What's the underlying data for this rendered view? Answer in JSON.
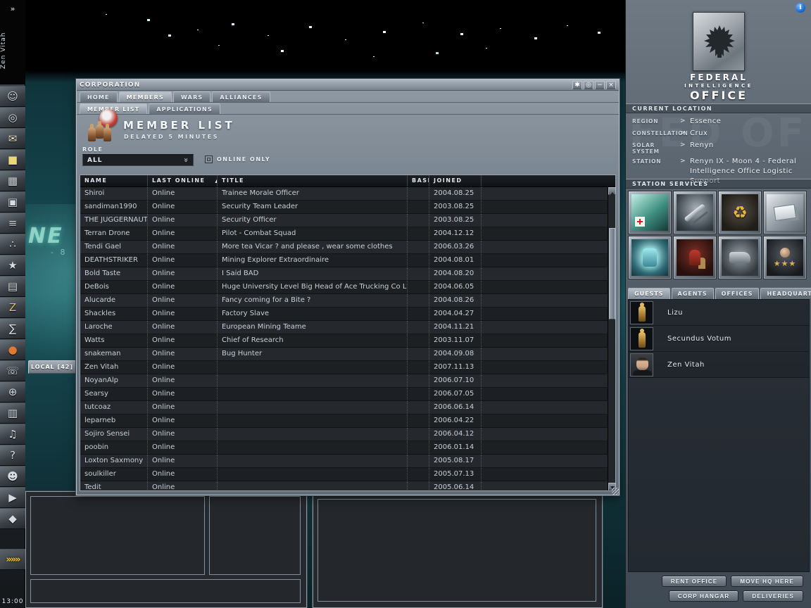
{
  "neocom": {
    "expand_label": "»",
    "character_name": "Zen Vitah",
    "clock": "13:00",
    "autopilot_label": "»»»",
    "icons": [
      "character-sheet",
      "people-and-places",
      "evemail",
      "notepad",
      "items",
      "station-monitor",
      "news",
      "fleet",
      "standings",
      "assets",
      "wallet",
      "market",
      "help",
      "channels",
      "browser",
      "journal",
      "jukebox",
      "aura-help",
      "character-customization",
      "ship-hangar",
      "insurance"
    ]
  },
  "background": {
    "local_chat_tab": "LOCAL [42]",
    "sign_text": "NE",
    "sign_subtext": "- 8"
  },
  "corp_window": {
    "title": "CORPORATION",
    "window_controls": [
      "pin",
      "opacity",
      "minimize",
      "close"
    ],
    "tabs": [
      "HOME",
      "MEMBERS",
      "WARS",
      "ALLIANCES"
    ],
    "active_tab": "MEMBERS",
    "subtabs": [
      "MEMBER LIST",
      "APPLICATIONS"
    ],
    "active_subtab": "MEMBER LIST",
    "heading": "MEMBER LIST",
    "subheading": "DELAYED 5 MINUTES",
    "role_label": "ROLE",
    "role_value": "ALL",
    "online_only_label": "ONLINE ONLY",
    "columns": [
      "NAME",
      "LAST ONLINE",
      "TITLE",
      "BASE",
      "JOINED"
    ],
    "sorted_column": "LAST ONLINE",
    "sort_direction": "asc",
    "members": [
      {
        "name": "Shiroi",
        "last_online": "Online",
        "title": "Trainee Morale Officer",
        "base": "",
        "joined": "2004.08.25"
      },
      {
        "name": "sandiman1990",
        "last_online": "Online",
        "title": "Security Team Leader",
        "base": "",
        "joined": "2003.08.25"
      },
      {
        "name": "THE JUGGERNAUT",
        "last_online": "Online",
        "title": "Security Officer",
        "base": "",
        "joined": "2003.08.25"
      },
      {
        "name": "Terran Drone",
        "last_online": "Online",
        "title": "Pilot - Combat Squad",
        "base": "",
        "joined": "2004.12.12"
      },
      {
        "name": "Tendi Gael",
        "last_online": "Online",
        "title": "More tea Vicar ? and please , wear some clothes",
        "base": "",
        "joined": "2006.03.26"
      },
      {
        "name": "DEATHSTRIKER",
        "last_online": "Online",
        "title": "Mining Explorer Extraordinaire",
        "base": "",
        "joined": "2004.08.01"
      },
      {
        "name": "Bold Taste",
        "last_online": "Online",
        "title": "I Said BAD",
        "base": "",
        "joined": "2004.08.20"
      },
      {
        "name": "DeBois",
        "last_online": "Online",
        "title": "Huge University Level Big Head of Ace Trucking Co Ltd.",
        "base": "",
        "joined": "2004.06.05"
      },
      {
        "name": "Alucarde",
        "last_online": "Online",
        "title": "Fancy coming for a Bite ?",
        "base": "",
        "joined": "2004.08.26"
      },
      {
        "name": "Shackles",
        "last_online": "Online",
        "title": "Factory Slave",
        "base": "",
        "joined": "2004.04.27"
      },
      {
        "name": "Laroche",
        "last_online": "Online",
        "title": "European Mining Teame",
        "base": "",
        "joined": "2004.11.21"
      },
      {
        "name": "Watts",
        "last_online": "Online",
        "title": "Chief of Research",
        "base": "",
        "joined": "2003.11.07"
      },
      {
        "name": "snakeman",
        "last_online": "Online",
        "title": "Bug Hunter",
        "base": "",
        "joined": "2004.09.08"
      },
      {
        "name": "Zen Vitah",
        "last_online": "Online",
        "title": "",
        "base": "",
        "joined": "2007.11.13"
      },
      {
        "name": "NoyanAlp",
        "last_online": "Online",
        "title": "",
        "base": "",
        "joined": "2006.07.10"
      },
      {
        "name": "Searsy",
        "last_online": "Online",
        "title": "",
        "base": "",
        "joined": "2006.07.05"
      },
      {
        "name": "tutcoaz",
        "last_online": "Online",
        "title": "",
        "base": "",
        "joined": "2006.06.14"
      },
      {
        "name": "leparneb",
        "last_online": "Online",
        "title": "",
        "base": "",
        "joined": "2006.04.22"
      },
      {
        "name": "Sojiro Sensei",
        "last_online": "Online",
        "title": "",
        "base": "",
        "joined": "2006.04.12"
      },
      {
        "name": "poobin",
        "last_online": "Online",
        "title": "",
        "base": "",
        "joined": "2006.01.14"
      },
      {
        "name": "Loxton Saxmony",
        "last_online": "Online",
        "title": "",
        "base": "",
        "joined": "2005.08.17"
      },
      {
        "name": "soulkiller",
        "last_online": "Online",
        "title": "",
        "base": "",
        "joined": "2005.07.13"
      },
      {
        "name": "Tedit",
        "last_online": "Online",
        "title": "",
        "base": "",
        "joined": "2005.06.14"
      }
    ]
  },
  "station_panel": {
    "corp_name_lines": [
      "FEDERAL",
      "INTELLIGENCE",
      "OFFICE"
    ],
    "watermark": "FED OF",
    "location": {
      "header": "CURRENT LOCATION",
      "rows": [
        {
          "label": "REGION",
          "value": "Essence"
        },
        {
          "label": "CONSTELLATION",
          "value": "Crux"
        },
        {
          "label": "SOLAR SYSTEM",
          "value": "Renyn"
        },
        {
          "label": "STATION",
          "value": "Renyn IX - Moon 4 - Federal Intelligence Office Logistic Support"
        }
      ]
    },
    "services_header": "STATION SERVICES",
    "services": [
      "medical",
      "repairshop",
      "reprocessing",
      "bounty",
      "fitting",
      "insurance",
      "factory",
      "navy"
    ],
    "tabs": [
      "GUESTS",
      "AGENTS",
      "OFFICES",
      "HEADQUARTERS"
    ],
    "active_tab": "GUESTS",
    "guests": [
      {
        "name": "Lizu",
        "portrait": "silhouette"
      },
      {
        "name": "Secundus Votum",
        "portrait": "silhouette"
      },
      {
        "name": "Zen Vitah",
        "portrait": "photo"
      }
    ],
    "buttons": [
      [
        "RENT OFFICE",
        "MOVE HQ HERE"
      ],
      [
        "CORP HANGAR",
        "DELIVERIES"
      ]
    ]
  }
}
